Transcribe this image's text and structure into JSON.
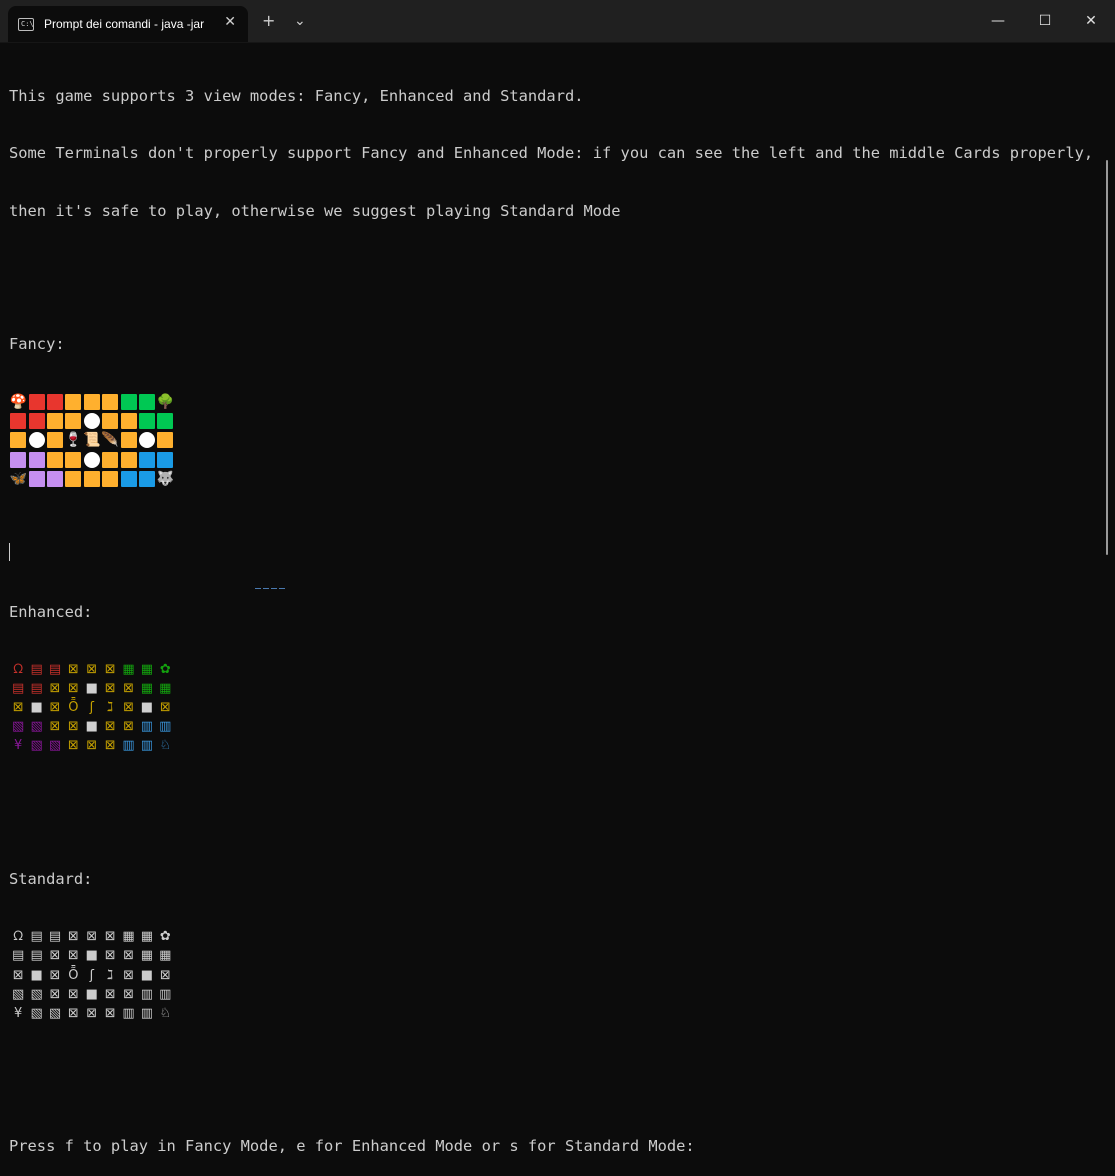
{
  "window": {
    "tab_title": "Prompt dei comandi - java  -jar",
    "tab_icon_text": "C:\\",
    "close_tab_glyph": "✕",
    "new_tab_glyph": "+",
    "dropdown_glyph": "⌄",
    "minimize_glyph": "—",
    "maximize_glyph": "☐",
    "close_glyph": "✕"
  },
  "terminal": {
    "intro_lines": [
      "This game supports 3 view modes: Fancy, Enhanced and Standard.",
      "Some Terminals don't properly support Fancy and Enhanced Mode: if you can see the left and the middle Cards properly,",
      "then it's safe to play, otherwise we suggest playing Standard Mode"
    ],
    "fancy_label": "Fancy:",
    "enhanced_label": "Enhanced:",
    "standard_label": "Standard:",
    "prompt": "Press f to play in Fancy Mode, e for Enhanced Mode or s for Standard Mode:"
  },
  "colors": {
    "red": "#e8362e",
    "orange": "#ffb02e",
    "green": "#00c853",
    "purple": "#c58ff0",
    "blue": "#1a9be6",
    "white": "#ffffff",
    "enh_red": "#c7312b",
    "enh_yellow": "#c4a000",
    "enh_green": "#13a10e",
    "enh_purple": "#881798",
    "enh_blue": "#3a96dd",
    "enh_white": "#d0d0d0",
    "std": "#cccccc"
  },
  "fancy_grid": [
    [
      [
        "e",
        "🍄"
      ],
      [
        "s",
        "red"
      ],
      [
        "s",
        "red"
      ],
      [
        "s",
        "orange"
      ],
      [
        "s",
        "orange"
      ],
      [
        "s",
        "orange"
      ],
      [
        "s",
        "green"
      ],
      [
        "s",
        "green"
      ],
      [
        "e",
        "🌳"
      ]
    ],
    [
      [
        "s",
        "red"
      ],
      [
        "s",
        "red"
      ],
      [
        "s",
        "orange"
      ],
      [
        "s",
        "orange"
      ],
      [
        "c",
        "white"
      ],
      [
        "s",
        "orange"
      ],
      [
        "s",
        "orange"
      ],
      [
        "s",
        "green"
      ],
      [
        "s",
        "green"
      ]
    ],
    [
      [
        "s",
        "orange"
      ],
      [
        "c",
        "white"
      ],
      [
        "s",
        "orange"
      ],
      [
        "e",
        "🍷"
      ],
      [
        "e",
        "📜"
      ],
      [
        "e",
        "🪶"
      ],
      [
        "s",
        "orange"
      ],
      [
        "c",
        "white"
      ],
      [
        "s",
        "orange"
      ]
    ],
    [
      [
        "s",
        "purple"
      ],
      [
        "s",
        "purple"
      ],
      [
        "s",
        "orange"
      ],
      [
        "s",
        "orange"
      ],
      [
        "c",
        "white"
      ],
      [
        "s",
        "orange"
      ],
      [
        "s",
        "orange"
      ],
      [
        "s",
        "blue"
      ],
      [
        "s",
        "blue"
      ]
    ],
    [
      [
        "e",
        "🦋"
      ],
      [
        "s",
        "purple"
      ],
      [
        "s",
        "purple"
      ],
      [
        "s",
        "orange"
      ],
      [
        "s",
        "orange"
      ],
      [
        "s",
        "orange"
      ],
      [
        "s",
        "blue"
      ],
      [
        "s",
        "blue"
      ],
      [
        "e",
        "🐺"
      ]
    ]
  ],
  "enhanced_grid": [
    [
      [
        "ᘯ",
        "enh_red"
      ],
      [
        "▤",
        "enh_red"
      ],
      [
        "▤",
        "enh_red"
      ],
      [
        "⊠",
        "enh_yellow"
      ],
      [
        "⊠",
        "enh_yellow"
      ],
      [
        "⊠",
        "enh_yellow"
      ],
      [
        "▦",
        "enh_green"
      ],
      [
        "▦",
        "enh_green"
      ],
      [
        "✿",
        "enh_green"
      ]
    ],
    [
      [
        "▤",
        "enh_red"
      ],
      [
        "▤",
        "enh_red"
      ],
      [
        "⊠",
        "enh_yellow"
      ],
      [
        "⊠",
        "enh_yellow"
      ],
      [
        "■",
        "enh_white"
      ],
      [
        "⊠",
        "enh_yellow"
      ],
      [
        "⊠",
        "enh_yellow"
      ],
      [
        "▦",
        "enh_green"
      ],
      [
        "▦",
        "enh_green"
      ]
    ],
    [
      [
        "⊠",
        "enh_yellow"
      ],
      [
        "■",
        "enh_white"
      ],
      [
        "⊠",
        "enh_yellow"
      ],
      [
        "Ȭ",
        "enh_yellow"
      ],
      [
        "ʃ",
        "enh_yellow"
      ],
      [
        "ℷ",
        "enh_yellow"
      ],
      [
        "⊠",
        "enh_yellow"
      ],
      [
        "■",
        "enh_white"
      ],
      [
        "⊠",
        "enh_yellow"
      ]
    ],
    [
      [
        "▧",
        "enh_purple"
      ],
      [
        "▧",
        "enh_purple"
      ],
      [
        "⊠",
        "enh_yellow"
      ],
      [
        "⊠",
        "enh_yellow"
      ],
      [
        "■",
        "enh_white"
      ],
      [
        "⊠",
        "enh_yellow"
      ],
      [
        "⊠",
        "enh_yellow"
      ],
      [
        "▥",
        "enh_blue"
      ],
      [
        "▥",
        "enh_blue"
      ]
    ],
    [
      [
        "¥",
        "enh_purple"
      ],
      [
        "▧",
        "enh_purple"
      ],
      [
        "▧",
        "enh_purple"
      ],
      [
        "⊠",
        "enh_yellow"
      ],
      [
        "⊠",
        "enh_yellow"
      ],
      [
        "⊠",
        "enh_yellow"
      ],
      [
        "▥",
        "enh_blue"
      ],
      [
        "▥",
        "enh_blue"
      ],
      [
        "♘",
        "enh_blue"
      ]
    ]
  ],
  "standard_grid": [
    [
      "ᘯ",
      "▤",
      "▤",
      "⊠",
      "⊠",
      "⊠",
      "▦",
      "▦",
      "✿"
    ],
    [
      "▤",
      "▤",
      "⊠",
      "⊠",
      "■",
      "⊠",
      "⊠",
      "▦",
      "▦"
    ],
    [
      "⊠",
      "■",
      "⊠",
      "Ȭ",
      "ʃ",
      "ℷ",
      "⊠",
      "■",
      "⊠"
    ],
    [
      "▧",
      "▧",
      "⊠",
      "⊠",
      "■",
      "⊠",
      "⊠",
      "▥",
      "▥"
    ],
    [
      "¥",
      "▧",
      "▧",
      "⊠",
      "⊠",
      "⊠",
      "▥",
      "▥",
      "♘"
    ]
  ]
}
